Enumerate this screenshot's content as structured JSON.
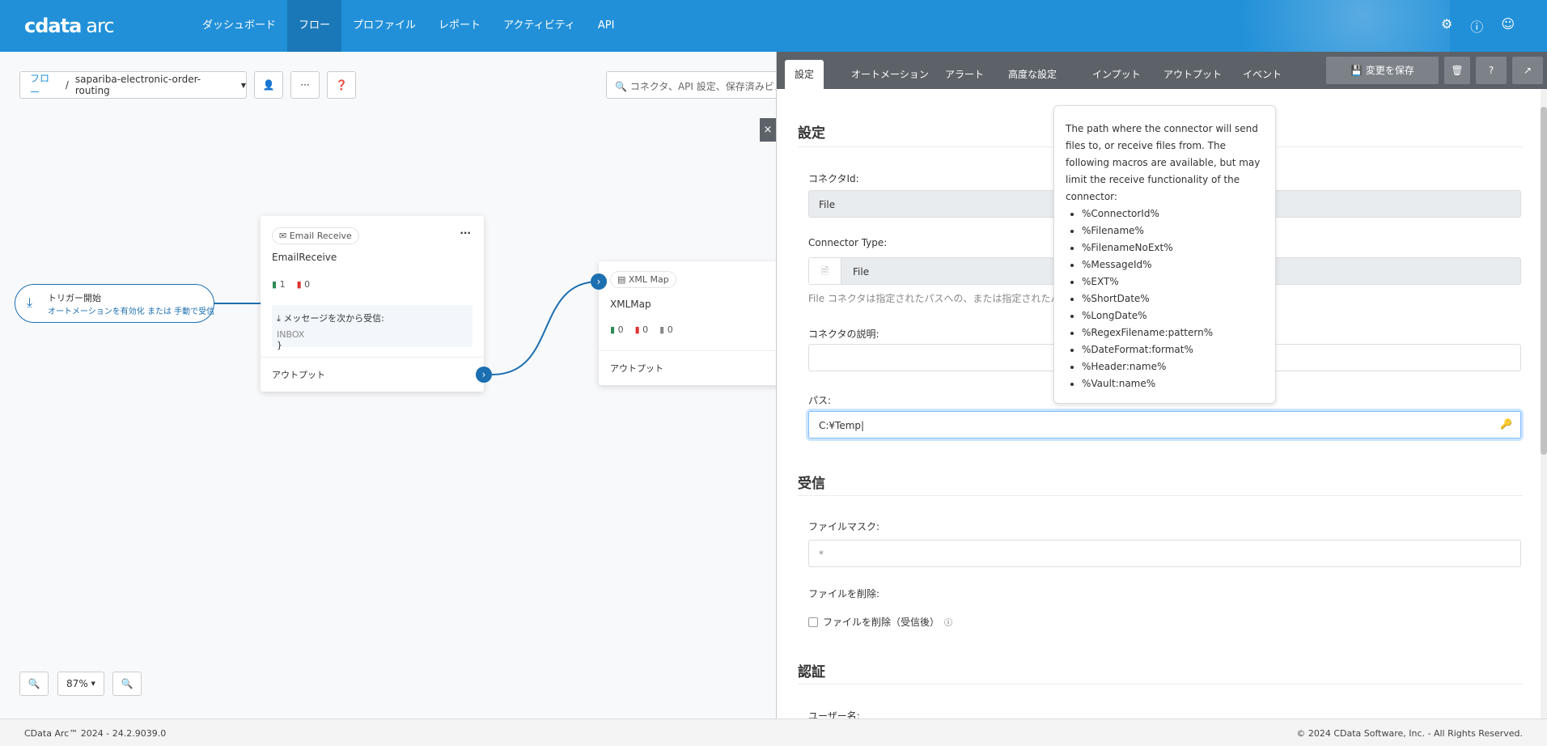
{
  "header": {
    "logo": "cdata",
    "logo_sub": "arc",
    "nav": [
      "ダッシュボード",
      "フロー",
      "プロファイル",
      "レポート",
      "アクティビティ",
      "API"
    ],
    "active_nav": 1
  },
  "toolbar": {
    "crumb_root": "フロー",
    "crumb_sep": "/",
    "flow_name": "sapariba-electronic-order-routing",
    "search_placeholder": "コネクタ、API 設定、保存済みビュー"
  },
  "canvas": {
    "trigger": {
      "title": "トリガー開始",
      "sub": "オートメーションを有効化 または 手動で受信"
    },
    "email": {
      "chip": "Email Receive",
      "name": "EmailReceive",
      "success": "1",
      "error": "0",
      "receive_label": "メッセージを次から受信:",
      "receive_value": "INBOX",
      "output": "アウトプット"
    },
    "xmlmap": {
      "chip": "XML Map",
      "name": "XMLMap",
      "success": "0",
      "error": "0",
      "pending": "0",
      "output": "アウトプット"
    },
    "zoom": "87%"
  },
  "panel": {
    "tabs": [
      "設定",
      "オートメーション",
      "アラート",
      "高度な設定",
      "インプット",
      "アウトプット",
      "イベント"
    ],
    "save": "変更を保存",
    "sections": {
      "settings": "設定",
      "receive": "受信",
      "auth": "認証"
    },
    "connector_id_label": "コネクタId:",
    "connector_id": "File",
    "connector_type_label": "Connector Type:",
    "connector_type": "File",
    "type_help": "File コネクタは指定されたパスへの、または指定されたパスから",
    "desc_label": "コネクタの説明:",
    "desc": "",
    "path_label": "パス:",
    "path": "C:¥Temp",
    "mask_label": "ファイルマスク:",
    "mask": "*",
    "delete_label": "ファイルを削除:",
    "delete_check": "ファイルを削除（受信後）",
    "user_label": "ユーザー名:"
  },
  "tooltip": {
    "intro": "The path where the connector will send files to, or receive files from. The following macros are available, but may limit the receive functionality of the connector:",
    "macros": [
      "%ConnectorId%",
      "%Filename%",
      "%FilenameNoExt%",
      "%MessageId%",
      "%EXT%",
      "%ShortDate%",
      "%LongDate%",
      "%RegexFilename:pattern%",
      "%DateFormat:format%",
      "%Header:name%",
      "%Vault:name%"
    ]
  },
  "footer": {
    "version": "CData Arc™ 2024 - 24.2.9039.0",
    "copyright": "© 2024 CData Software, Inc. - All Rights Reserved."
  }
}
